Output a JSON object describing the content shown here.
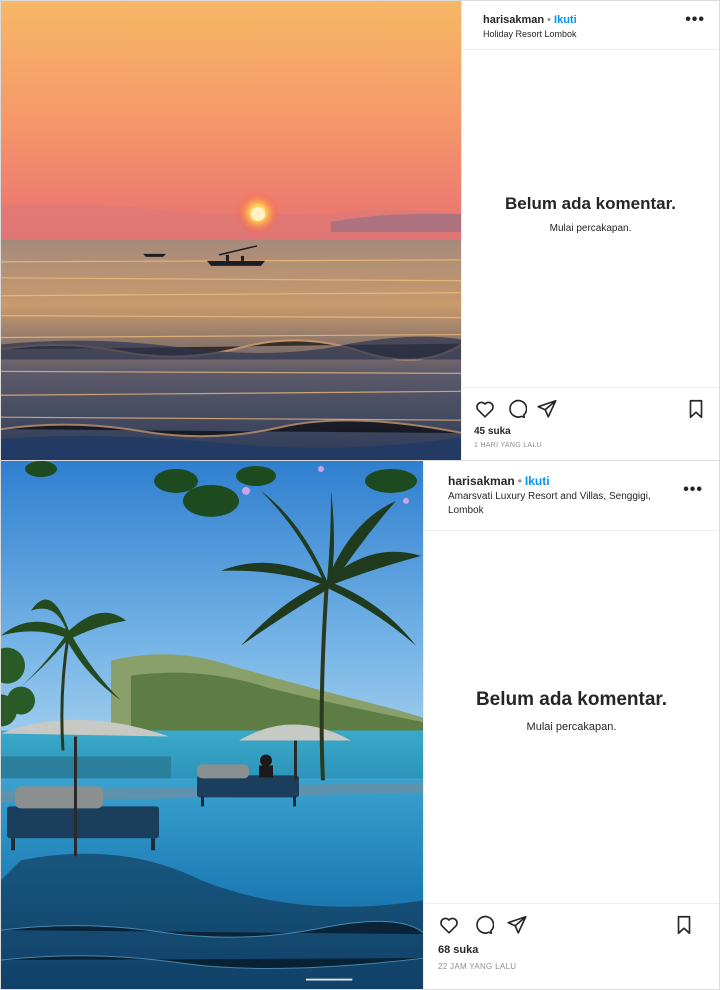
{
  "posts": [
    {
      "username": "harisakman",
      "separator": "•",
      "follow_label": "Ikuti",
      "location": "Holiday Resort Lombok",
      "more_label": "•••",
      "empty_title": "Belum ada komentar.",
      "empty_subtitle": "Mulai percakapan.",
      "likes": "45 suka",
      "time": "1 HARI YANG LALU"
    },
    {
      "username": "harisakman",
      "separator": "•",
      "follow_label": "Ikuti",
      "location": "Amarsvati Luxury Resort and Villas, Senggigi, Lombok",
      "more_label": "•••",
      "empty_title": "Belum ada komentar.",
      "empty_subtitle": "Mulai percakapan.",
      "likes": "68 suka",
      "time": "22 JAM YANG LALU"
    }
  ],
  "icons": {
    "like": "heart-icon",
    "comment": "comment-icon",
    "share": "paper-plane-icon",
    "save": "bookmark-icon",
    "more": "more-options-icon"
  },
  "colors": {
    "follow": "#0095f6",
    "text": "#262626",
    "muted": "#8e8e8e",
    "border": "#dbdbdb"
  }
}
